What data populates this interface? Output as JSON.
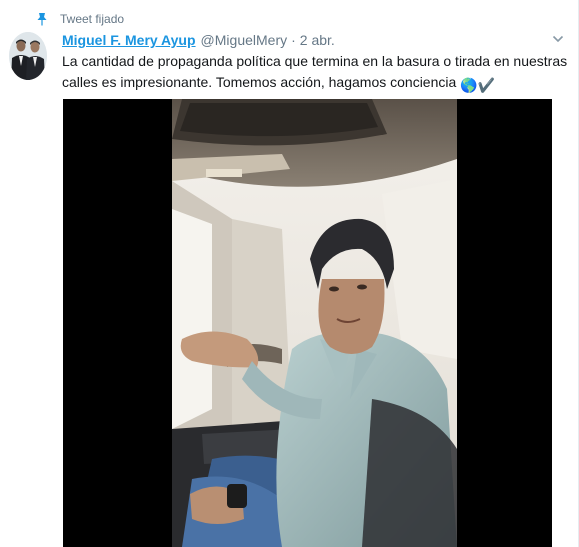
{
  "pinned": {
    "label": "Tweet fijado",
    "icon": "pin-icon"
  },
  "tweet": {
    "author_name": "Miguel F. Mery Ayup",
    "handle": "@MiguelMery",
    "separator": "·",
    "timestamp": "2 abr.",
    "text": "La cantidad de propaganda política que termina en la basura o tirada en nuestras calles es impresionante. Tomemos acción, hagamos conciencia",
    "emoji_1": "🌎",
    "emoji_2": "✔️"
  },
  "icons": {
    "menu": "chevron-down-icon",
    "avatar": "avatar",
    "media": "video-player"
  },
  "colors": {
    "link": "#1b95e0",
    "secondary": "#657786",
    "text": "#14171a",
    "media_bg": "#000000"
  }
}
